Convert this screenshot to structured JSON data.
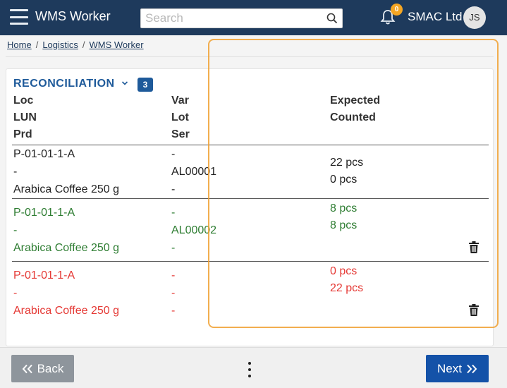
{
  "app": {
    "title": "WMS Worker",
    "company": "SMAC Ltd",
    "user_initials": "JS",
    "notifications": "0"
  },
  "search": {
    "placeholder": "Search"
  },
  "breadcrumb": [
    "Home",
    "Logistics",
    "WMS Worker"
  ],
  "section": {
    "title": "RECONCILIATION",
    "count": "3"
  },
  "columns": {
    "col1": [
      "Loc",
      "LUN",
      "Prd"
    ],
    "col2": [
      "Var",
      "Lot",
      "Ser"
    ],
    "col3": [
      "Expected",
      "Counted"
    ]
  },
  "rows": [
    {
      "status": "normal",
      "loc": "P-01-01-1-A",
      "lun": "-",
      "prd": "Arabica Coffee 250 g",
      "var": "-",
      "lot": "AL00001",
      "ser": "-",
      "expected": "22 pcs",
      "counted": "0 pcs",
      "deletable": false
    },
    {
      "status": "match",
      "loc": "P-01-01-1-A",
      "lun": "-",
      "prd": "Arabica Coffee 250 g",
      "var": "-",
      "lot": "AL00002",
      "ser": "-",
      "expected": "8 pcs",
      "counted": "8 pcs",
      "deletable": true
    },
    {
      "status": "mismatch",
      "loc": "P-01-01-1-A",
      "lun": "-",
      "prd": "Arabica Coffee 250 g",
      "var": "-",
      "lot": "-",
      "ser": "-",
      "expected": "0 pcs",
      "counted": "22 pcs",
      "deletable": true
    }
  ],
  "footer": {
    "back_label": "Back",
    "next_label": "Next"
  },
  "colors": {
    "topbar": "#1e3a5c",
    "accent": "#1e5a9a",
    "match": "#2e7d32",
    "mismatch": "#e53935",
    "next": "#1452a8",
    "back": "#8e959c",
    "badge": "#f5a623"
  },
  "icons": [
    "hamburger-icon",
    "search-icon",
    "bell-icon",
    "chevron-down-icon",
    "trash-icon",
    "double-chevron-left-icon",
    "double-chevron-right-icon",
    "more-vertical-icon"
  ]
}
